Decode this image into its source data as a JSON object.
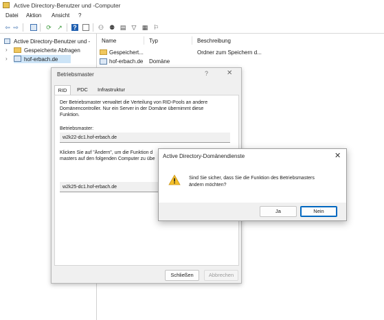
{
  "window": {
    "title": "Active Directory-Benutzer und -Computer"
  },
  "menu": [
    "Datei",
    "Aktion",
    "Ansicht",
    "?"
  ],
  "toolbar_icons": [
    "back-icon",
    "forward-icon",
    "folder-up-icon",
    "console-tree-icon",
    "refresh-icon",
    "export-icon",
    "help-icon",
    "properties-icon",
    "new-user-icon",
    "new-group-icon",
    "new-ou-icon",
    "filter-icon",
    "find-icon",
    "add-to-group-icon"
  ],
  "tree": {
    "root": "Active Directory-Benutzer und -",
    "items": [
      {
        "label": "Gespeicherte Abfragen"
      },
      {
        "label": "hof-erbach.de"
      }
    ]
  },
  "list": {
    "columns": [
      "Name",
      "Typ",
      "Beschreibung"
    ],
    "rows": [
      {
        "name": "Gespeichert...",
        "type": "",
        "description": "Ordner zum Speichern d..."
      },
      {
        "name": "hof-erbach.de",
        "type": "Domäne",
        "description": ""
      }
    ]
  },
  "master_dialog": {
    "title": "Betriebsmaster",
    "help": "?",
    "tabs": [
      "RID",
      "PDC",
      "Infrastruktur"
    ],
    "description": [
      "Der Betriebsmaster verwaltet die Verteilung von RID-Pools an andere",
      "Domänencontroller. Nur ein Server in der Domäne übernimmt diese",
      "Funktion."
    ],
    "master_label": "Betriebsmaster:",
    "master_value": "w2k22-dc1.hof-erbach.de",
    "change_text": [
      "Klicken Sie auf \"Ändern\", um die Funktion d",
      "masters auf den folgenden Computer zu übe"
    ],
    "target_value": "w2k25-dc1.hof-erbach.de",
    "close_label": "Schließen",
    "cancel_label": "Abbrechen"
  },
  "confirm_dialog": {
    "title": "Active Directory-Domänendienste",
    "message": [
      "Sind Sie sicher, dass Sie die Funktion des Betriebsmasters",
      "ändern möchten?"
    ],
    "yes_label": "Ja",
    "no_label": "Nein"
  },
  "colors": {
    "accent": "#0067c0",
    "warning": "#f5c02a",
    "selection": "#cce4f7",
    "folder": "#f0c75e"
  }
}
